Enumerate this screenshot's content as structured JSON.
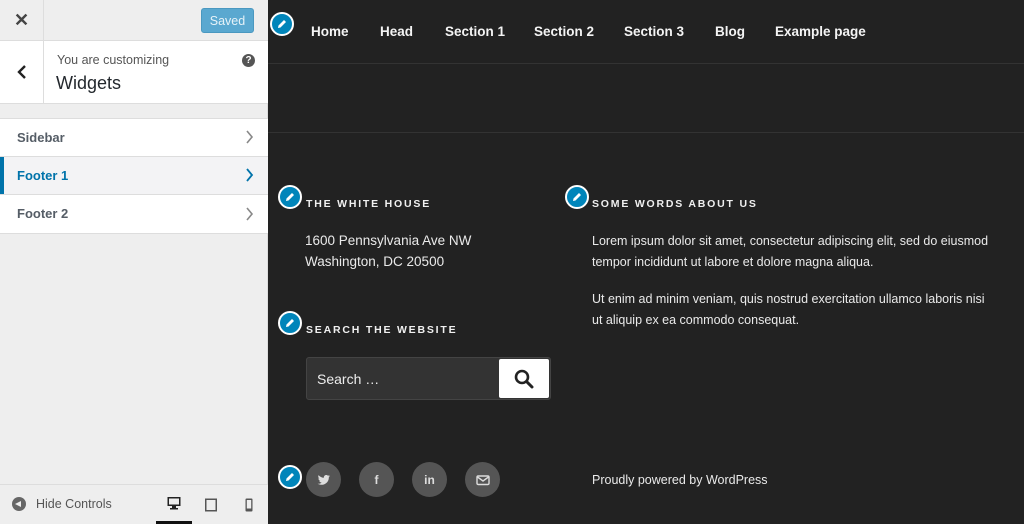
{
  "panel": {
    "saved_label": "Saved",
    "customizing_label": "You are customizing",
    "section_title": "Widgets",
    "widget_areas": [
      {
        "label": "Sidebar"
      },
      {
        "label": "Footer 1"
      },
      {
        "label": "Footer 2"
      }
    ],
    "active_widget_area": "Footer 1",
    "hide_controls_label": "Hide Controls",
    "devices": [
      "desktop",
      "tablet",
      "mobile"
    ],
    "accent_color": "#0073aa",
    "saved_button_color": "#5aa8d0"
  },
  "site": {
    "nav": [
      "Home",
      "Head",
      "Section 1",
      "Section 2",
      "Section 3",
      "Blog",
      "Example page"
    ],
    "footer": {
      "address_widget": {
        "title": "THE WHITE HOUSE",
        "lines": [
          "1600 Pennsylvania Ave NW",
          "Washington, DC 20500"
        ]
      },
      "search_widget": {
        "title": "SEARCH THE WEBSITE",
        "placeholder": "Search …"
      },
      "about_widget": {
        "title": "SOME WORDS ABOUT US",
        "paragraphs": [
          "Lorem ipsum dolor sit amet, consectetur adipiscing elit, sed do eiusmod tempor incididunt ut labore et dolore magna aliqua.",
          "Ut enim ad minim veniam, quis nostrud exercitation ullamco laboris nisi ut aliquip ex ea commodo consequat."
        ]
      },
      "social_icons": [
        "twitter-icon",
        "facebook-icon",
        "linkedin-icon",
        "email-icon"
      ],
      "powered_by": "Proudly powered by WordPress"
    },
    "background_color": "#222222",
    "edit_shortcut_color": "#0085ba"
  }
}
